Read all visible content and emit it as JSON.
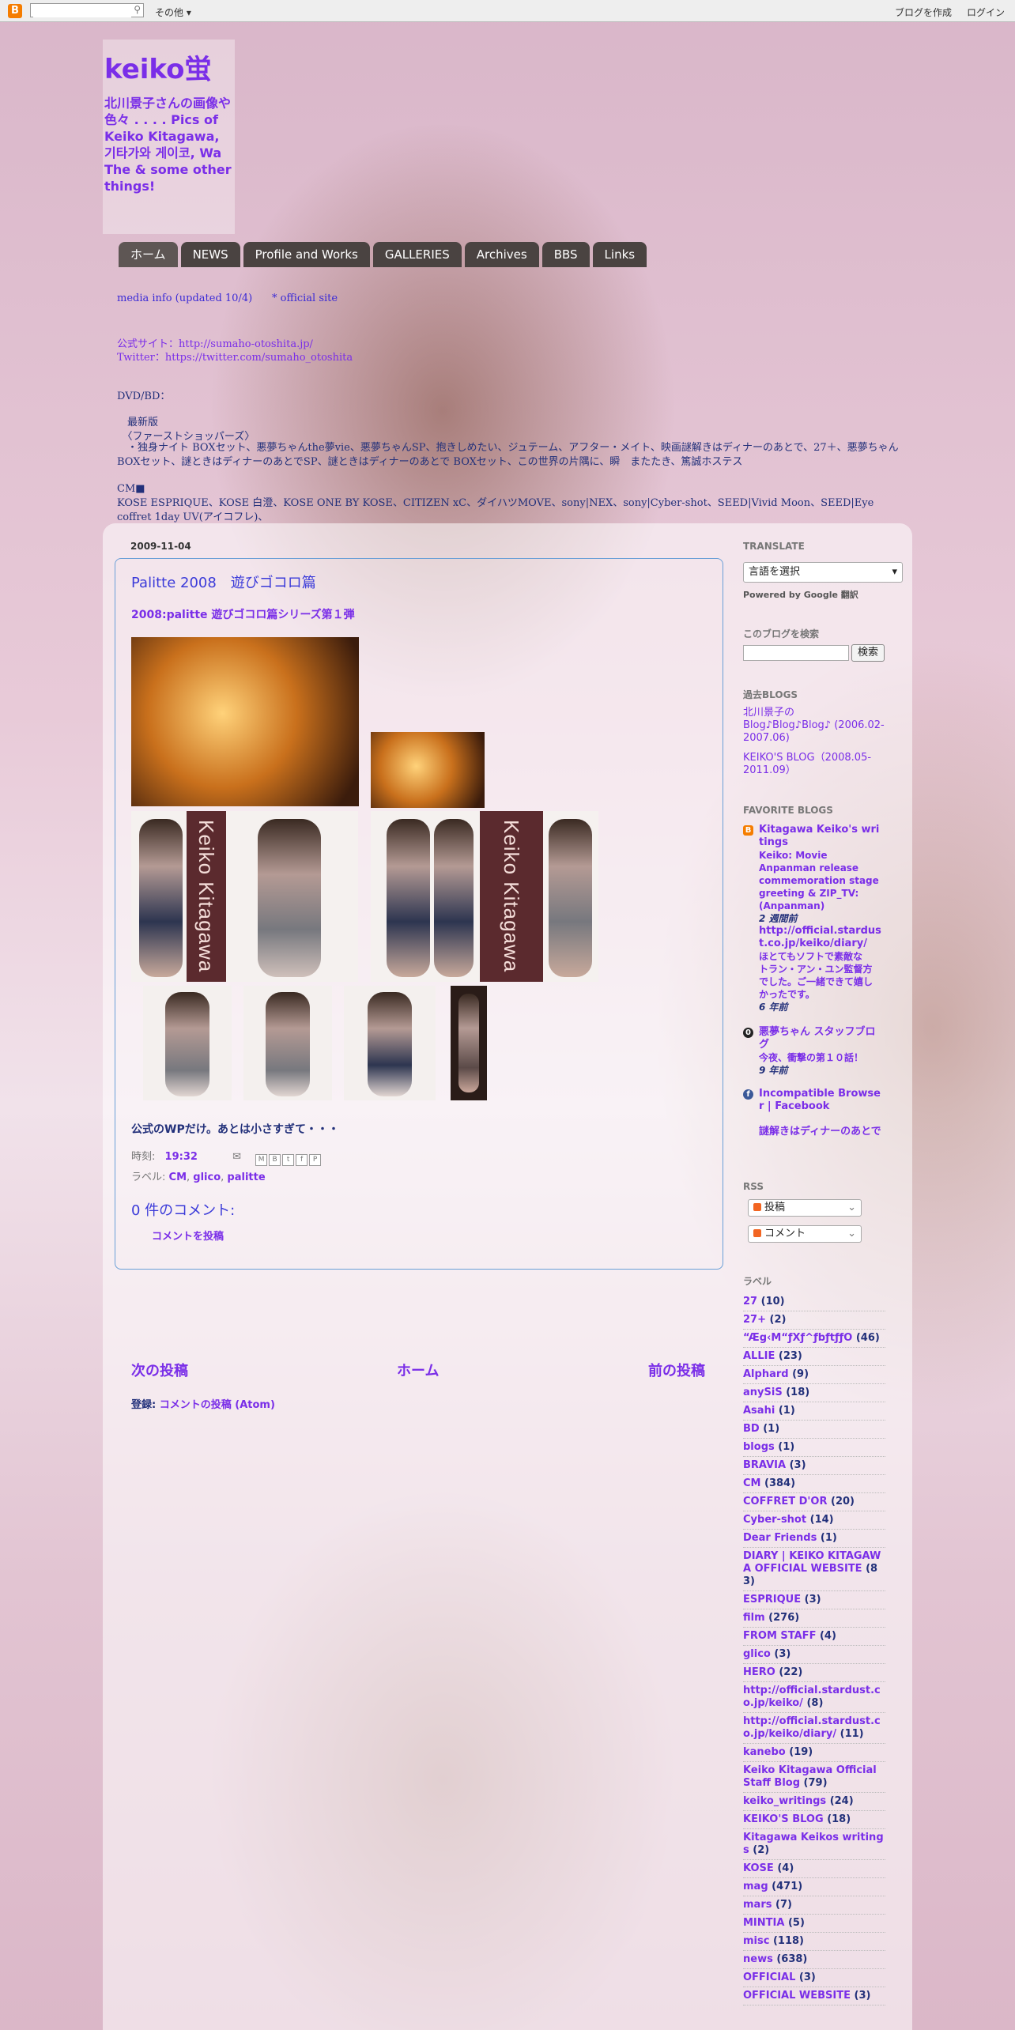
{
  "navbar": {
    "logo": "B",
    "search_placeholder": "",
    "more": "その他",
    "create_blog": "ブログを作成",
    "login": "ログイン"
  },
  "header": {
    "title": "keiko蛍",
    "description": "北川景子さんの画像や色々 . . . . Pics of Keiko Kitagawa, 기타가와 게이코, Wa The & some other things!"
  },
  "tabs": [
    "ホーム",
    "NEWS",
    "Profile and Works",
    "GALLERIES",
    "Archives",
    "BBS",
    "Links"
  ],
  "header_links": {
    "media_info": "media info (updated 10/4)",
    "official": "* official site",
    "sumaho_label": "公式サイト：",
    "sumaho_url": "http://sumaho-otoshita.jp/",
    "twitter_label": "Twitter：",
    "twitter_url": "https://twitter.com/sumaho_otoshita"
  },
  "info": {
    "heading": "DVD/BD：",
    "line1": "　最新版",
    "line2": "　〈ファーストショッパーズ〉",
    "line3": "　・独身ナイト BOXセット、悪夢ちゃんthe夢vie、悪夢ちゃんSP、抱きしめたい、ジュテーム、アフター・メイト、映画謎解きはディナーのあとで、27＋、悪夢ちゃん BOXセット、謎ときはディナーのあとでSP、謎ときはディナーのあとで BOXセット、この世界の片隅に、瞬　またたき、篤誠ホステス",
    "cm_heading": "CM■",
    "cm_line": "KOSE ESPRIQUE、KOSE 白澄、KOSE ONE BY KOSE、CITIZEN xC、ダイハツMOVE、sony|NEX、sony|Cyber-shot、SEED|Vivid Moon、SEED|Eye coffret 1day UV(アイコフレ)、"
  },
  "post": {
    "date": "2009-11-04",
    "title": "Palitte 2008　遊びゴコロ篇",
    "subtitle": "2008:palitte 遊びゴコロ篇シリーズ第１弾",
    "band_text": "Keiko Kitagawa",
    "body": "公式のWPだけ。あとは小さすぎて・・・",
    "time_label": "時刻:",
    "time": "19:32",
    "labels_label": "ラベル:",
    "labels": [
      "CM",
      "glico",
      "palitte"
    ],
    "comments_heading": "0 件のコメント:",
    "post_comment": "コメントを投稿"
  },
  "pager": {
    "newer": "次の投稿",
    "home": "ホーム",
    "older": "前の投稿",
    "subscribe_label": "登録:",
    "subscribe_link": "コメントの投稿 (Atom)"
  },
  "sidebar": {
    "translate_heading": "TRANSLATE",
    "translate_select": "言語を選択",
    "powered": "Powered by Google 翻訳",
    "search_heading": "このブログを検索",
    "search_button": "検索",
    "past_heading": "過去BLOGS",
    "past_links": [
      "北川景子の Blog♪Blog♪Blog♪ (2006.02-2007.06)",
      "KEIKO'S BLOG（2008.05-2011.09）"
    ],
    "fav_heading": "FAVORITE BLOGS",
    "favorites": [
      {
        "icon": "blogger",
        "title": "Kitagawa Keiko's writings",
        "snippet": "Keiko: Movie Anpanman release commemoration stage greeting & ZIP_TV: (Anpanman)",
        "time": "2 週間前"
      },
      {
        "icon": "",
        "title": "http://official.stardust.co.jp/keiko/diary/",
        "snippet": "トラン・アン・ユン監督方でした。ご一緒できて嬉しかったです。",
        "snippet_prefix": "ほとてもソフトで素敵な",
        "time": "6 年前"
      },
      {
        "icon": "ameba",
        "title": "悪夢ちゃん スタッフブログ",
        "snippet": "今夜、衝撃の第１０話！",
        "time": "9 年前"
      },
      {
        "icon": "facebook",
        "title": "Incompatible Browser | Facebook",
        "snippet": "",
        "time": ""
      },
      {
        "icon": "",
        "title": "謎解きはディナーのあとで",
        "snippet": "",
        "time": ""
      }
    ],
    "rss_heading": "RSS",
    "rss_posts": "投稿",
    "rss_comments": "コメント",
    "labels_heading": "ラベル",
    "labels": [
      {
        "name": "27",
        "count": "(10)"
      },
      {
        "name": "27+",
        "count": "(2)"
      },
      {
        "name": "“Æ̃g‹M“ƒXƒ^ƒbƒtƒƒO",
        "count": "(46)"
      },
      {
        "name": "ALLIE",
        "count": "(23)"
      },
      {
        "name": "Alphard",
        "count": "(9)"
      },
      {
        "name": "anySiS",
        "count": "(18)"
      },
      {
        "name": "Asahi",
        "count": "(1)"
      },
      {
        "name": "BD",
        "count": "(1)"
      },
      {
        "name": "blogs",
        "count": "(1)"
      },
      {
        "name": "BRAVIA",
        "count": "(3)"
      },
      {
        "name": "CM",
        "count": "(384)"
      },
      {
        "name": "COFFRET D'OR",
        "count": "(20)"
      },
      {
        "name": "Cyber-shot",
        "count": "(14)"
      },
      {
        "name": "Dear Friends",
        "count": "(1)"
      },
      {
        "name": "DIARY | KEIKO KITAGAWA OFFICIAL WEBSITE",
        "count": "(83)"
      },
      {
        "name": "ESPRIQUE",
        "count": "(3)"
      },
      {
        "name": "film",
        "count": "(276)"
      },
      {
        "name": "FROM STAFF",
        "count": "(4)"
      },
      {
        "name": "glico",
        "count": "(3)"
      },
      {
        "name": "HERO",
        "count": "(22)"
      },
      {
        "name": "http://official.stardust.co.jp/keiko/",
        "count": "(8)"
      },
      {
        "name": "http://official.stardust.co.jp/keiko/diary/",
        "count": "(11)"
      },
      {
        "name": "kanebo",
        "count": "(19)"
      },
      {
        "name": "Keiko Kitagawa Official Staff Blog",
        "count": "(79)"
      },
      {
        "name": "keiko_writings",
        "count": "(24)"
      },
      {
        "name": "KEIKO'S BLOG",
        "count": "(18)"
      },
      {
        "name": "Kitagawa Keikos writings",
        "count": "(2)"
      },
      {
        "name": "KOSE",
        "count": "(4)"
      },
      {
        "name": "mag",
        "count": "(471)"
      },
      {
        "name": "mars",
        "count": "(7)"
      },
      {
        "name": "MINTIA",
        "count": "(5)"
      },
      {
        "name": "misc",
        "count": "(118)"
      },
      {
        "name": "news",
        "count": "(638)"
      },
      {
        "name": "OFFICIAL",
        "count": "(3)"
      },
      {
        "name": "OFFICIAL WEBSITE",
        "count": "(3)"
      }
    ]
  }
}
